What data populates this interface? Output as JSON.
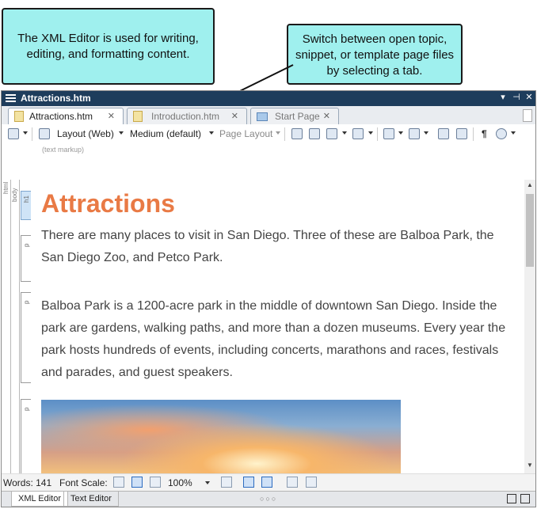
{
  "callouts": {
    "editor_note": "The XML Editor is used for writing, editing, and formatting content.",
    "tabs_note": "Switch between open topic, snippet, or template page files by selecting a tab."
  },
  "window": {
    "title": "Attractions.htm",
    "buttons": [
      "▾",
      "⊣",
      "✕"
    ]
  },
  "tabs": [
    {
      "label": "Attractions.htm",
      "close": "✕",
      "active": true
    },
    {
      "label": "Introduction.htm",
      "close": "✕",
      "active": false
    },
    {
      "label": "Start Page",
      "close": "✕",
      "active": false
    }
  ],
  "toolbar": {
    "layout": "Layout (Web)",
    "medium": "Medium (default)",
    "page_layout": "Page Layout",
    "pilcrow": "¶",
    "markup_label": "(text markup)"
  },
  "structure": {
    "html": "html",
    "body": "body",
    "h1": "h1",
    "p": "p"
  },
  "content": {
    "heading": "Attractions",
    "para1": "There are many places to visit in San Diego. Three of these are Balboa Park, the San Diego Zoo, and Petco Park.",
    "para2": "Balboa Park is a 1200-acre park in the middle of downtown San Diego. Inside the park are gardens, walking paths, and more than a dozen museums. Every year the park hosts hundreds of events, including concerts, marathons and races, festivals and parades, and guest speakers."
  },
  "status": {
    "words": "Words: 141",
    "font_scale": "Font Scale:",
    "zoom": "100%"
  },
  "bottom_tabs": [
    "XML Editor",
    "Text Editor"
  ],
  "bottom_dots": "○○○",
  "colors": {
    "callout_bg": "#9ff0ee",
    "titlebar_bg": "#1e3d5c",
    "heading": "#e97a45"
  }
}
